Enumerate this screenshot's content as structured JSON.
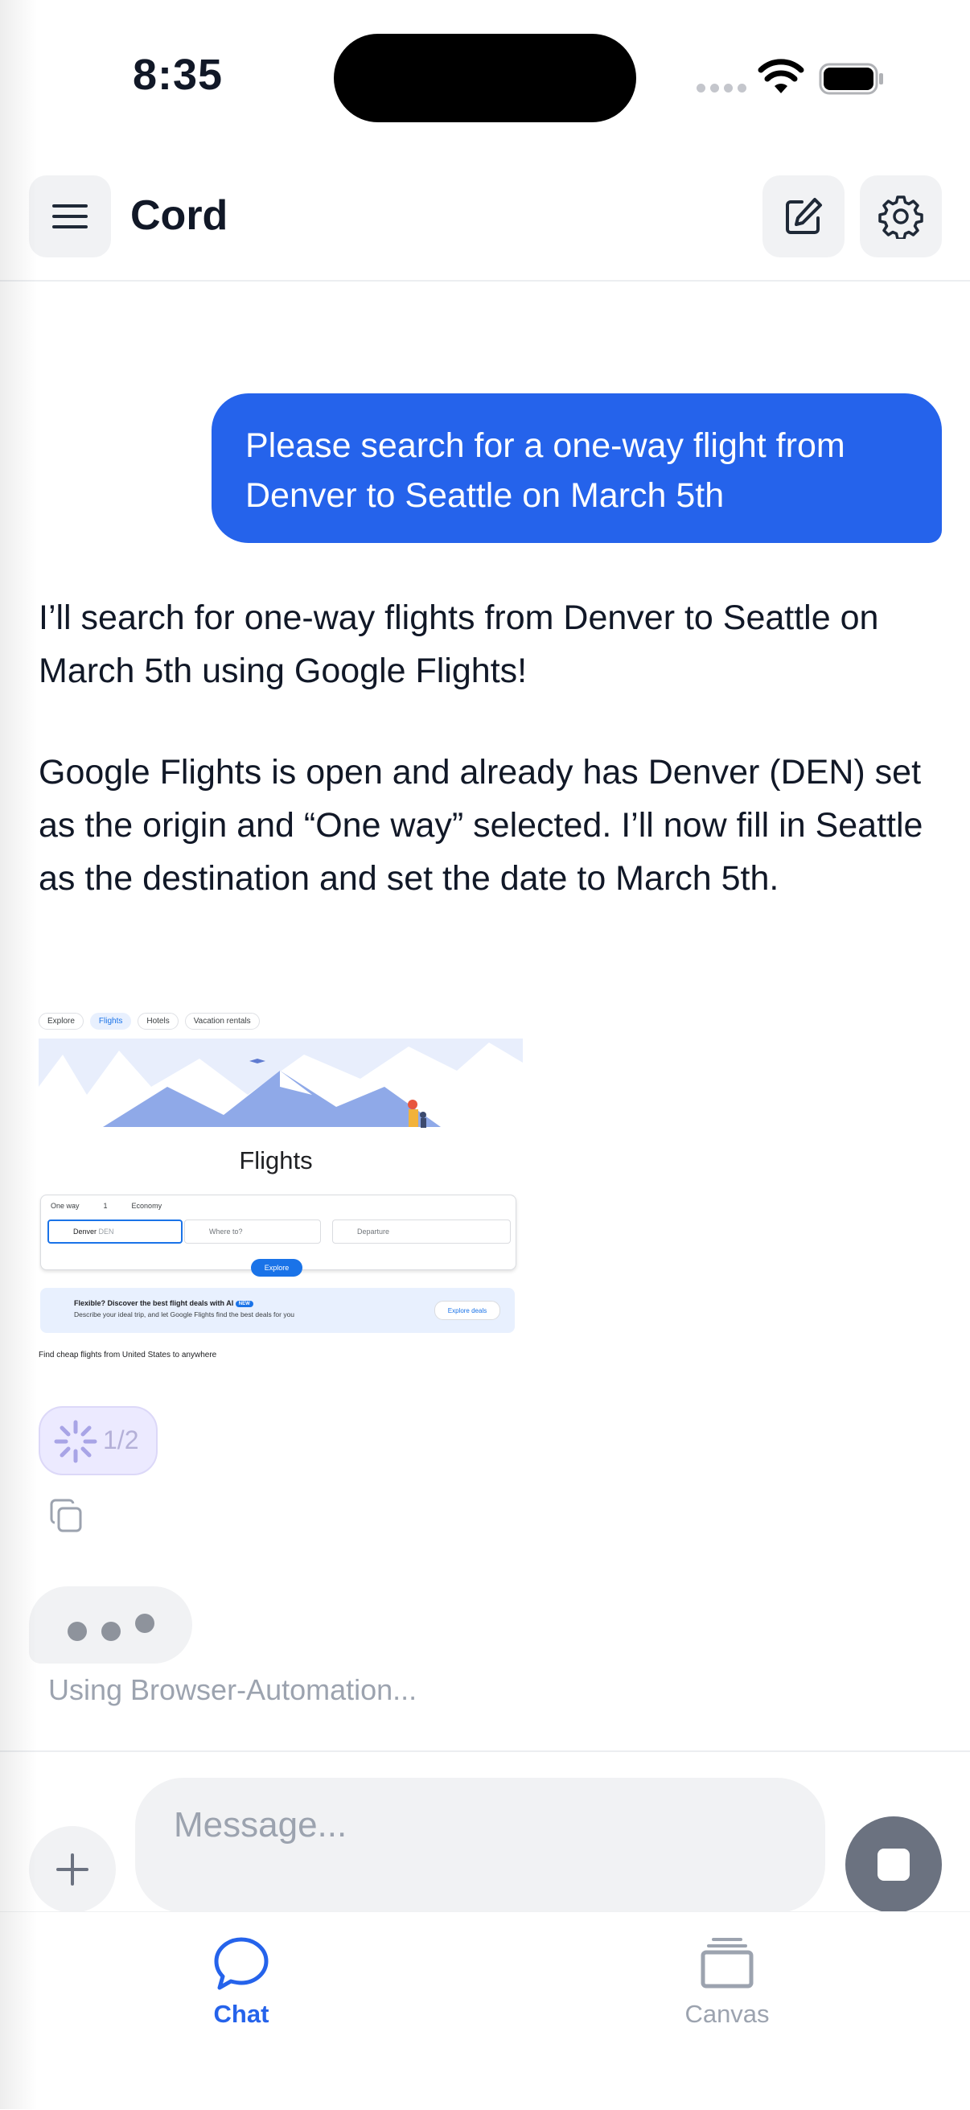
{
  "status_bar": {
    "time": "8:35"
  },
  "header": {
    "title": "Cord"
  },
  "chat": {
    "user_message": "Please search for a one-way flight from Denver to Seattle on March 5th",
    "assistant_paragraphs": [
      "I’ll search for one-way flights from Denver to Seattle on March 5th using Google Flights!",
      "Google Flights is open and already has Denver (DEN) set as the origin and “One way” selected. I’ll now fill in Seattle as the destination and set the date to March 5th."
    ],
    "screenshot": {
      "tabs": [
        "Explore",
        "Flights",
        "Hotels",
        "Vacation rentals"
      ],
      "title": "Flights",
      "trip_type": "One way",
      "passengers": "1",
      "cabin": "Economy",
      "from_value": "Denver",
      "from_code": "DEN",
      "to_placeholder": "Where to?",
      "date_placeholder": "Departure",
      "explore_button": "Explore",
      "ai_heading": "Flexible? Discover the best flight deals with AI",
      "ai_badge": "NEW",
      "ai_body": "Describe your ideal trip, and let Google Flights find the best deals for you",
      "ai_button": "Explore deals",
      "footer": "Find cheap flights from United States to anywhere"
    },
    "progress": "1/2",
    "tool_status": "Using Browser-Automation..."
  },
  "composer": {
    "placeholder": "Message..."
  },
  "tabs": {
    "chat": "Chat",
    "canvas": "Canvas"
  },
  "colors": {
    "accent": "#2563eb",
    "bubble": "#2563eb",
    "muted": "#9ca3af"
  },
  "icons": [
    "menu-icon",
    "compose-icon",
    "gear-icon",
    "copy-icon",
    "plus-icon",
    "stop-icon",
    "chat-bubble-icon",
    "canvas-stack-icon"
  ]
}
